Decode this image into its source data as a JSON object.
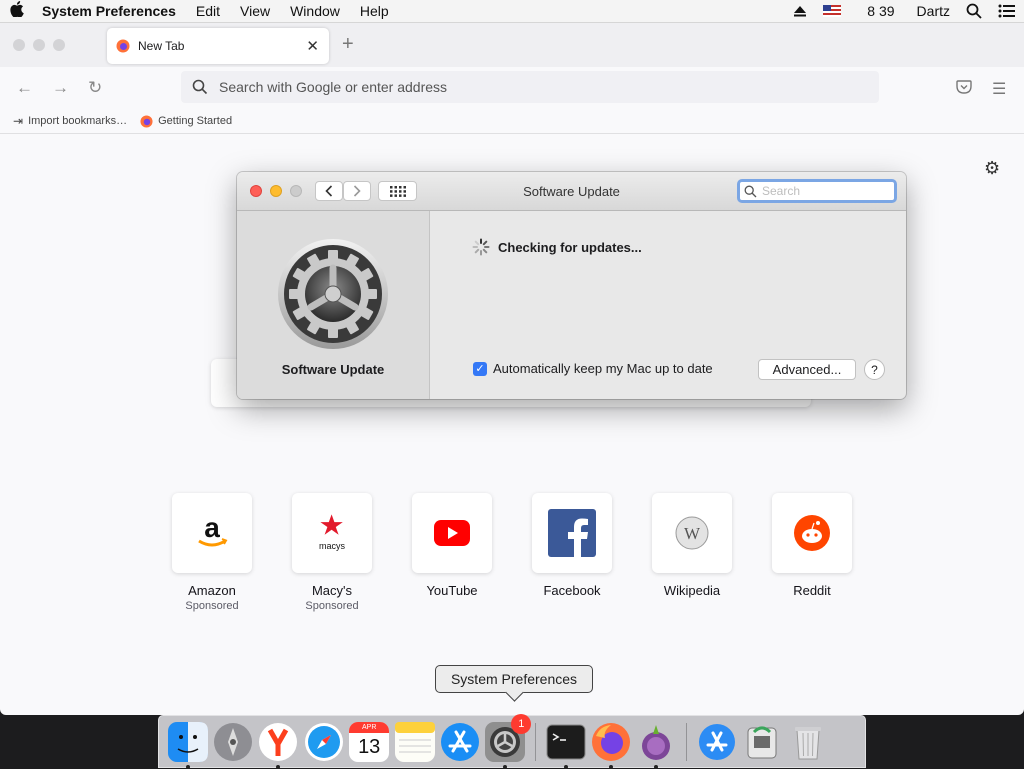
{
  "menubar": {
    "app_name": "System Preferences",
    "menus": [
      "Edit",
      "View",
      "Window",
      "Help"
    ],
    "clock": "8 39",
    "user": "Dartz"
  },
  "browser": {
    "tab_title": "New Tab",
    "url_placeholder": "Search with Google or enter address",
    "bookmarks": [
      "Import bookmarks…",
      "Getting Started"
    ]
  },
  "top_sites": [
    {
      "name": "Amazon",
      "sponsor": "Sponsored",
      "icon": "amazon-logo"
    },
    {
      "name": "Macy's",
      "sponsor": "Sponsored",
      "icon": "macys-logo"
    },
    {
      "name": "YouTube",
      "sponsor": "",
      "icon": "youtube-logo"
    },
    {
      "name": "Facebook",
      "sponsor": "",
      "icon": "facebook-logo"
    },
    {
      "name": "Wikipedia",
      "sponsor": "",
      "icon": "wikipedia-logo"
    },
    {
      "name": "Reddit",
      "sponsor": "",
      "icon": "reddit-logo"
    }
  ],
  "dialog": {
    "title": "Software Update",
    "search_placeholder": "Search",
    "pane_label": "Software Update",
    "status": "Checking for updates...",
    "auto_update_label": "Automatically keep my Mac up to date",
    "auto_update_checked": true,
    "advanced_button": "Advanced...",
    "help_button": "?"
  },
  "dock": {
    "tooltip": "System Preferences",
    "calendar_month": "APR",
    "calendar_day": "13",
    "badge_count": "1",
    "items": [
      "Finder",
      "Launchpad",
      "Yandex",
      "Safari",
      "Calendar",
      "Notes",
      "App Store",
      "System Preferences",
      "Terminal",
      "Firefox",
      "Tor Browser",
      "Downloads",
      "Printer",
      "Trash"
    ]
  },
  "colors": {
    "accent": "#3478f6",
    "close": "#fe5f57",
    "minimize": "#febc2e",
    "badge": "#fe3b30"
  }
}
